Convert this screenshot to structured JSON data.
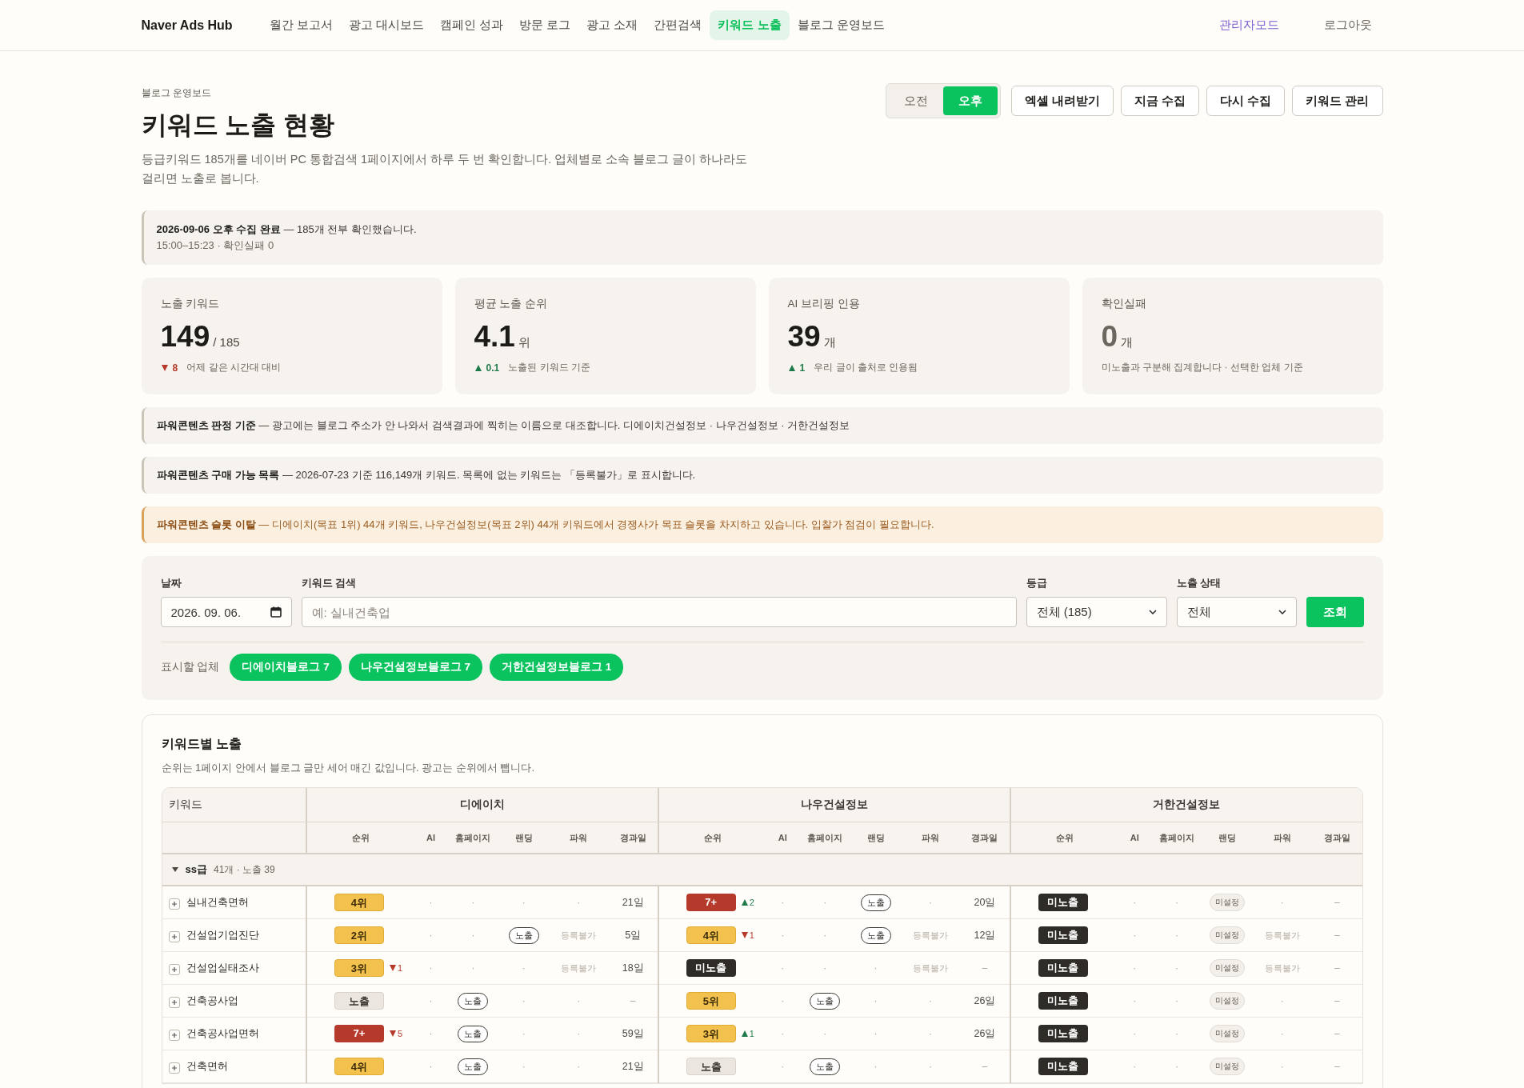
{
  "nav": {
    "brand": "Naver Ads Hub",
    "items": [
      {
        "label": "월간 보고서",
        "selected": false
      },
      {
        "label": "광고 대시보드",
        "selected": false
      },
      {
        "label": "캠페인 성과",
        "selected": false
      },
      {
        "label": "방문 로그",
        "selected": false
      },
      {
        "label": "광고 소재",
        "selected": false
      },
      {
        "label": "간편검색",
        "selected": false
      },
      {
        "label": "키워드 노출",
        "selected": true
      },
      {
        "label": "블로그 운영보드",
        "selected": false
      }
    ],
    "links": [
      {
        "label": "관리자모드",
        "accent": true
      },
      {
        "label": "로그아웃",
        "accent": false
      }
    ]
  },
  "header": {
    "breadcrumb": "블로그 운영보드",
    "title": "키워드 노출 현황",
    "description": "등급키워드 185개를 네이버 PC 통합검색 1페이지에서 하루 두 번 확인합니다. 업체별로 소속 블로그 글이 하나라도 걸리면 노출로 봅니다.",
    "period": [
      {
        "label": "오전",
        "selected": false
      },
      {
        "label": "오후",
        "selected": true
      }
    ],
    "buttons": [
      "엑셀 내려받기",
      "지금 수집",
      "다시 수집",
      "키워드 관리"
    ]
  },
  "status": {
    "text": "**2026-09-06 오후 수집 완료** — 185개 전부 확인했습니다.",
    "subtext": "15:00–15:23 · 확인실패 0"
  },
  "stats": [
    {
      "label": "노출 키워드",
      "value": "149",
      "unit": "/ 185",
      "delta": {
        "rising": false,
        "value": "8"
      },
      "note": "어제 같은 시간대 대비",
      "muted": false
    },
    {
      "label": "평균 노출 순위",
      "value": "4.1",
      "unit": "위",
      "delta": {
        "rising": true,
        "value": "0.1"
      },
      "note": "노출된 키워드 기준",
      "muted": false
    },
    {
      "label": "AI 브리핑 인용",
      "value": "39",
      "unit": "개",
      "delta": {
        "rising": true,
        "value": "1"
      },
      "note": "우리 글이 출처로 인용됨",
      "muted": false
    },
    {
      "label": "확인실패",
      "value": "0",
      "unit": "개",
      "note": "미노출과 구분해 집계합니다 · 선택한 업체 기준",
      "muted": true
    }
  ],
  "notices": [
    {
      "kind": "info",
      "text": "**파워콘텐츠 판정 기준** — 광고에는 블로그 주소가 안 나와서 검색결과에 찍히는 이름으로 대조합니다. 디에이치건설정보 · 나우건설정보 · 거한건설정보"
    },
    {
      "kind": "info",
      "text": "**파워콘텐츠 구매 가능 목록** — 2026-07-23 기준 116,149개 키워드. 목록에 없는 키워드는 「등록불가」로 표시합니다."
    },
    {
      "kind": "warn",
      "text": "**파워콘텐츠 슬롯 이탈** — 디에이치(목표 1위) 44개 키워드, 나우건설정보(목표 2위) 44개 키워드에서 경쟁사가 목표 슬롯을 차지하고 있습니다. 입찰가 점검이 필요합니다."
    }
  ],
  "filters": {
    "date": {
      "label": "날짜",
      "value": "2026. 09. 06."
    },
    "keyword": {
      "label": "키워드 검색",
      "placeholder": "예: 실내건축업"
    },
    "grade": {
      "label": "등급",
      "value": "전체 (185)"
    },
    "exposure": {
      "label": "노출 상태",
      "value": "전체"
    },
    "submit": "조회",
    "companies_label": "표시할 업체",
    "companies": [
      {
        "label": "디에이치블로그 7",
        "selected": true
      },
      {
        "label": "나우건설정보블로그 7",
        "selected": true
      },
      {
        "label": "거한건설정보블로그 1",
        "selected": true
      }
    ]
  },
  "table": {
    "title": "키워드별 노출",
    "description": "순위는 1페이지 안에서 블로그 글만 세어 매긴 값입니다. 광고는 순위에서 뺍니다.",
    "keyword_header": "키워드",
    "groups": [
      {
        "name": "디에이치",
        "columns": [
          "순위",
          "AI",
          "홈페이지",
          "랜딩",
          "파워",
          "경과일"
        ]
      },
      {
        "name": "나우건설정보",
        "columns": [
          "순위",
          "AI",
          "홈페이지",
          "랜딩",
          "파워",
          "경과일"
        ]
      },
      {
        "name": "거한건설정보",
        "columns": [
          "순위",
          "AI",
          "홈페이지",
          "랜딩",
          "파워",
          "경과일"
        ]
      }
    ],
    "sections": [
      {
        "name": "ss급",
        "summary": "41개 · 노출 39",
        "expanded": true,
        "rows": [
          {
            "keyword": "실내건축면허",
            "groups": [
              {
                "rank": {
                  "kind": "gold",
                  "text": "4위"
                },
                "cells": [
                  {
                    "kind": "dot",
                    "text": "·"
                  },
                  {
                    "kind": "dot",
                    "text": "·"
                  },
                  {
                    "kind": "dot",
                    "text": "·"
                  },
                  {
                    "kind": "dot",
                    "text": "·"
                  },
                  {
                    "kind": "days",
                    "text": "21일"
                  }
                ]
              },
              {
                "rank": {
                  "kind": "red",
                  "text": "7+"
                },
                "change": {
                  "rising": true,
                  "value": "2"
                },
                "cells": [
                  {
                    "kind": "dot",
                    "text": "·"
                  },
                  {
                    "kind": "dot",
                    "text": "·"
                  },
                  {
                    "kind": "pill",
                    "text": "노출"
                  },
                  {
                    "kind": "dot",
                    "text": "·"
                  },
                  {
                    "kind": "days",
                    "text": "20일"
                  }
                ]
              },
              {
                "rank": {
                  "kind": "dark",
                  "text": "미노출"
                },
                "cells": [
                  {
                    "kind": "dot",
                    "text": "·"
                  },
                  {
                    "kind": "dot",
                    "text": "·"
                  },
                  {
                    "kind": "unset",
                    "text": "미설정"
                  },
                  {
                    "kind": "dot",
                    "text": "·"
                  },
                  {
                    "kind": "dash",
                    "text": "–"
                  }
                ]
              }
            ]
          },
          {
            "keyword": "건설업기업진단",
            "groups": [
              {
                "rank": {
                  "kind": "gold",
                  "text": "2위"
                },
                "cells": [
                  {
                    "kind": "dot",
                    "text": "·"
                  },
                  {
                    "kind": "dot",
                    "text": "·"
                  },
                  {
                    "kind": "pill",
                    "text": "노출"
                  },
                  {
                    "kind": "muted",
                    "text": "등록불가"
                  },
                  {
                    "kind": "days",
                    "text": "5일"
                  }
                ]
              },
              {
                "rank": {
                  "kind": "gold",
                  "text": "4위"
                },
                "change": {
                  "rising": false,
                  "value": "1"
                },
                "cells": [
                  {
                    "kind": "dot",
                    "text": "·"
                  },
                  {
                    "kind": "dot",
                    "text": "·"
                  },
                  {
                    "kind": "pill",
                    "text": "노출"
                  },
                  {
                    "kind": "muted",
                    "text": "등록불가"
                  },
                  {
                    "kind": "days",
                    "text": "12일"
                  }
                ]
              },
              {
                "rank": {
                  "kind": "dark",
                  "text": "미노출"
                },
                "cells": [
                  {
                    "kind": "dot",
                    "text": "·"
                  },
                  {
                    "kind": "dot",
                    "text": "·"
                  },
                  {
                    "kind": "unset",
                    "text": "미설정"
                  },
                  {
                    "kind": "muted",
                    "text": "등록불가"
                  },
                  {
                    "kind": "dash",
                    "text": "–"
                  }
                ]
              }
            ]
          },
          {
            "keyword": "건설업실태조사",
            "groups": [
              {
                "rank": {
                  "kind": "gold",
                  "text": "3위"
                },
                "change": {
                  "rising": false,
                  "value": "1"
                },
                "cells": [
                  {
                    "kind": "dot",
                    "text": "·"
                  },
                  {
                    "kind": "dot",
                    "text": "·"
                  },
                  {
                    "kind": "dot",
                    "text": "·"
                  },
                  {
                    "kind": "muted",
                    "text": "등록불가"
                  },
                  {
                    "kind": "days",
                    "text": "18일"
                  }
                ]
              },
              {
                "rank": {
                  "kind": "dark",
                  "text": "미노출"
                },
                "cells": [
                  {
                    "kind": "dot",
                    "text": "·"
                  },
                  {
                    "kind": "dot",
                    "text": "·"
                  },
                  {
                    "kind": "dot",
                    "text": "·"
                  },
                  {
                    "kind": "muted",
                    "text": "등록불가"
                  },
                  {
                    "kind": "dash",
                    "text": "–"
                  }
                ]
              },
              {
                "rank": {
                  "kind": "dark",
                  "text": "미노출"
                },
                "cells": [
                  {
                    "kind": "dot",
                    "text": "·"
                  },
                  {
                    "kind": "dot",
                    "text": "·"
                  },
                  {
                    "kind": "unset",
                    "text": "미설정"
                  },
                  {
                    "kind": "muted",
                    "text": "등록불가"
                  },
                  {
                    "kind": "dash",
                    "text": "–"
                  }
                ]
              }
            ]
          },
          {
            "keyword": "건축공사업",
            "groups": [
              {
                "rank": {
                  "kind": "gray",
                  "text": "노출"
                },
                "cells": [
                  {
                    "kind": "dot",
                    "text": "·"
                  },
                  {
                    "kind": "pill",
                    "text": "노출"
                  },
                  {
                    "kind": "dot",
                    "text": "·"
                  },
                  {
                    "kind": "dot",
                    "text": "·"
                  },
                  {
                    "kind": "dash",
                    "text": "–"
                  }
                ]
              },
              {
                "rank": {
                  "kind": "gold",
                  "text": "5위"
                },
                "cells": [
                  {
                    "kind": "dot",
                    "text": "·"
                  },
                  {
                    "kind": "pill",
                    "text": "노출"
                  },
                  {
                    "kind": "dot",
                    "text": "·"
                  },
                  {
                    "kind": "dot",
                    "text": "·"
                  },
                  {
                    "kind": "days",
                    "text": "26일"
                  }
                ]
              },
              {
                "rank": {
                  "kind": "dark",
                  "text": "미노출"
                },
                "cells": [
                  {
                    "kind": "dot",
                    "text": "·"
                  },
                  {
                    "kind": "dot",
                    "text": "·"
                  },
                  {
                    "kind": "unset",
                    "text": "미설정"
                  },
                  {
                    "kind": "dot",
                    "text": "·"
                  },
                  {
                    "kind": "dash",
                    "text": "–"
                  }
                ]
              }
            ]
          },
          {
            "keyword": "건축공사업면허",
            "groups": [
              {
                "rank": {
                  "kind": "red",
                  "text": "7+"
                },
                "change": {
                  "rising": false,
                  "value": "5"
                },
                "cells": [
                  {
                    "kind": "dot",
                    "text": "·"
                  },
                  {
                    "kind": "pill",
                    "text": "노출"
                  },
                  {
                    "kind": "dot",
                    "text": "·"
                  },
                  {
                    "kind": "dot",
                    "text": "·"
                  },
                  {
                    "kind": "days",
                    "text": "59일"
                  }
                ]
              },
              {
                "rank": {
                  "kind": "gold",
                  "text": "3위"
                },
                "change": {
                  "rising": true,
                  "value": "1"
                },
                "cells": [
                  {
                    "kind": "dot",
                    "text": "·"
                  },
                  {
                    "kind": "dot",
                    "text": "·"
                  },
                  {
                    "kind": "dot",
                    "text": "·"
                  },
                  {
                    "kind": "dot",
                    "text": "·"
                  },
                  {
                    "kind": "days",
                    "text": "26일"
                  }
                ]
              },
              {
                "rank": {
                  "kind": "dark",
                  "text": "미노출"
                },
                "cells": [
                  {
                    "kind": "dot",
                    "text": "·"
                  },
                  {
                    "kind": "dot",
                    "text": "·"
                  },
                  {
                    "kind": "unset",
                    "text": "미설정"
                  },
                  {
                    "kind": "dot",
                    "text": "·"
                  },
                  {
                    "kind": "dash",
                    "text": "–"
                  }
                ]
              }
            ]
          },
          {
            "keyword": "건축면허",
            "groups": [
              {
                "rank": {
                  "kind": "gold",
                  "text": "4위"
                },
                "cells": [
                  {
                    "kind": "dot",
                    "text": "·"
                  },
                  {
                    "kind": "pill",
                    "text": "노출"
                  },
                  {
                    "kind": "dot",
                    "text": "·"
                  },
                  {
                    "kind": "dot",
                    "text": "·"
                  },
                  {
                    "kind": "days",
                    "text": "21일"
                  }
                ]
              },
              {
                "rank": {
                  "kind": "gray",
                  "text": "노출"
                },
                "cells": [
                  {
                    "kind": "dot",
                    "text": "·"
                  },
                  {
                    "kind": "pill",
                    "text": "노출"
                  },
                  {
                    "kind": "dot",
                    "text": "·"
                  },
                  {
                    "kind": "dot",
                    "text": "·"
                  },
                  {
                    "kind": "dash",
                    "text": "–"
                  }
                ]
              },
              {
                "rank": {
                  "kind": "dark",
                  "text": "미노출"
                },
                "cells": [
                  {
                    "kind": "dot",
                    "text": "·"
                  },
                  {
                    "kind": "dot",
                    "text": "·"
                  },
                  {
                    "kind": "unset",
                    "text": "미설정"
                  },
                  {
                    "kind": "dot",
                    "text": "·"
                  },
                  {
                    "kind": "dash",
                    "text": "–"
                  }
                ]
              }
            ]
          }
        ]
      }
    ]
  }
}
